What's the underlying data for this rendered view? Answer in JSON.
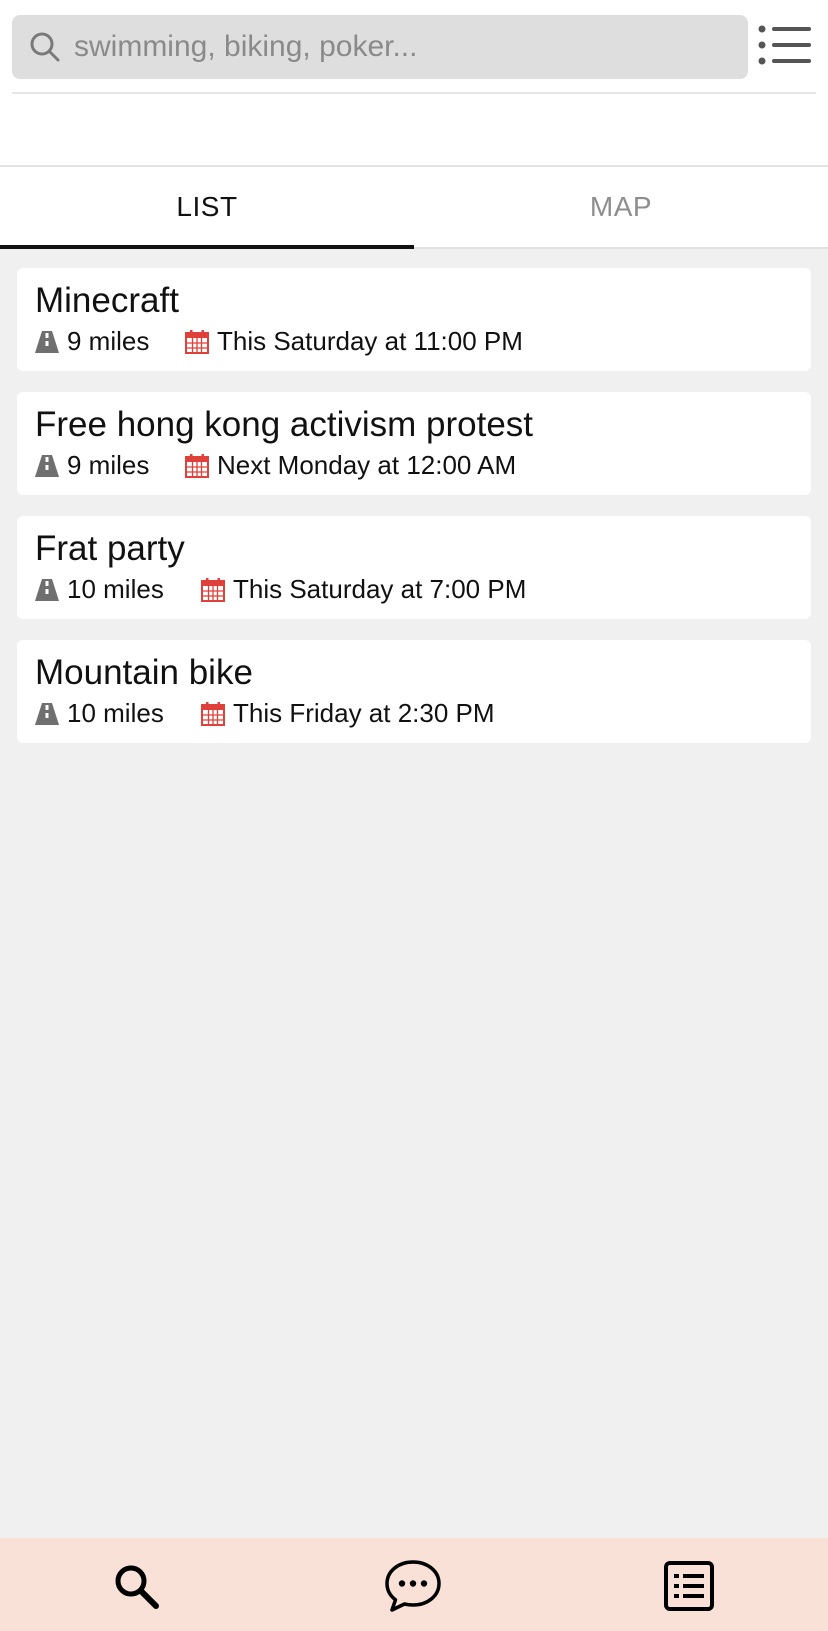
{
  "search": {
    "placeholder": "swimming, biking, poker...",
    "value": ""
  },
  "tabs": [
    {
      "label": "LIST",
      "active": true
    },
    {
      "label": "MAP",
      "active": false
    }
  ],
  "events": [
    {
      "title": "Minecraft",
      "distance": "9 miles",
      "when": "This Saturday at 11:00 PM"
    },
    {
      "title": "Free hong kong activism protest",
      "distance": "9 miles",
      "when": "Next Monday at 12:00 AM"
    },
    {
      "title": "Frat party",
      "distance": "10 miles",
      "when": "This Saturday at 7:00 PM"
    },
    {
      "title": "Mountain bike",
      "distance": "10 miles",
      "when": "This Friday at 2:30 PM"
    }
  ],
  "icons": {
    "search": "search-icon",
    "menu": "list-menu-icon",
    "distance": "road-icon",
    "date": "calendar-icon",
    "nav_search": "search-icon",
    "nav_chat": "chat-bubble-icon",
    "nav_list": "list-document-icon"
  },
  "colors": {
    "accent": "#e0403a",
    "nav_background": "#f9e1d8",
    "page_background": "#f0f0f0"
  }
}
